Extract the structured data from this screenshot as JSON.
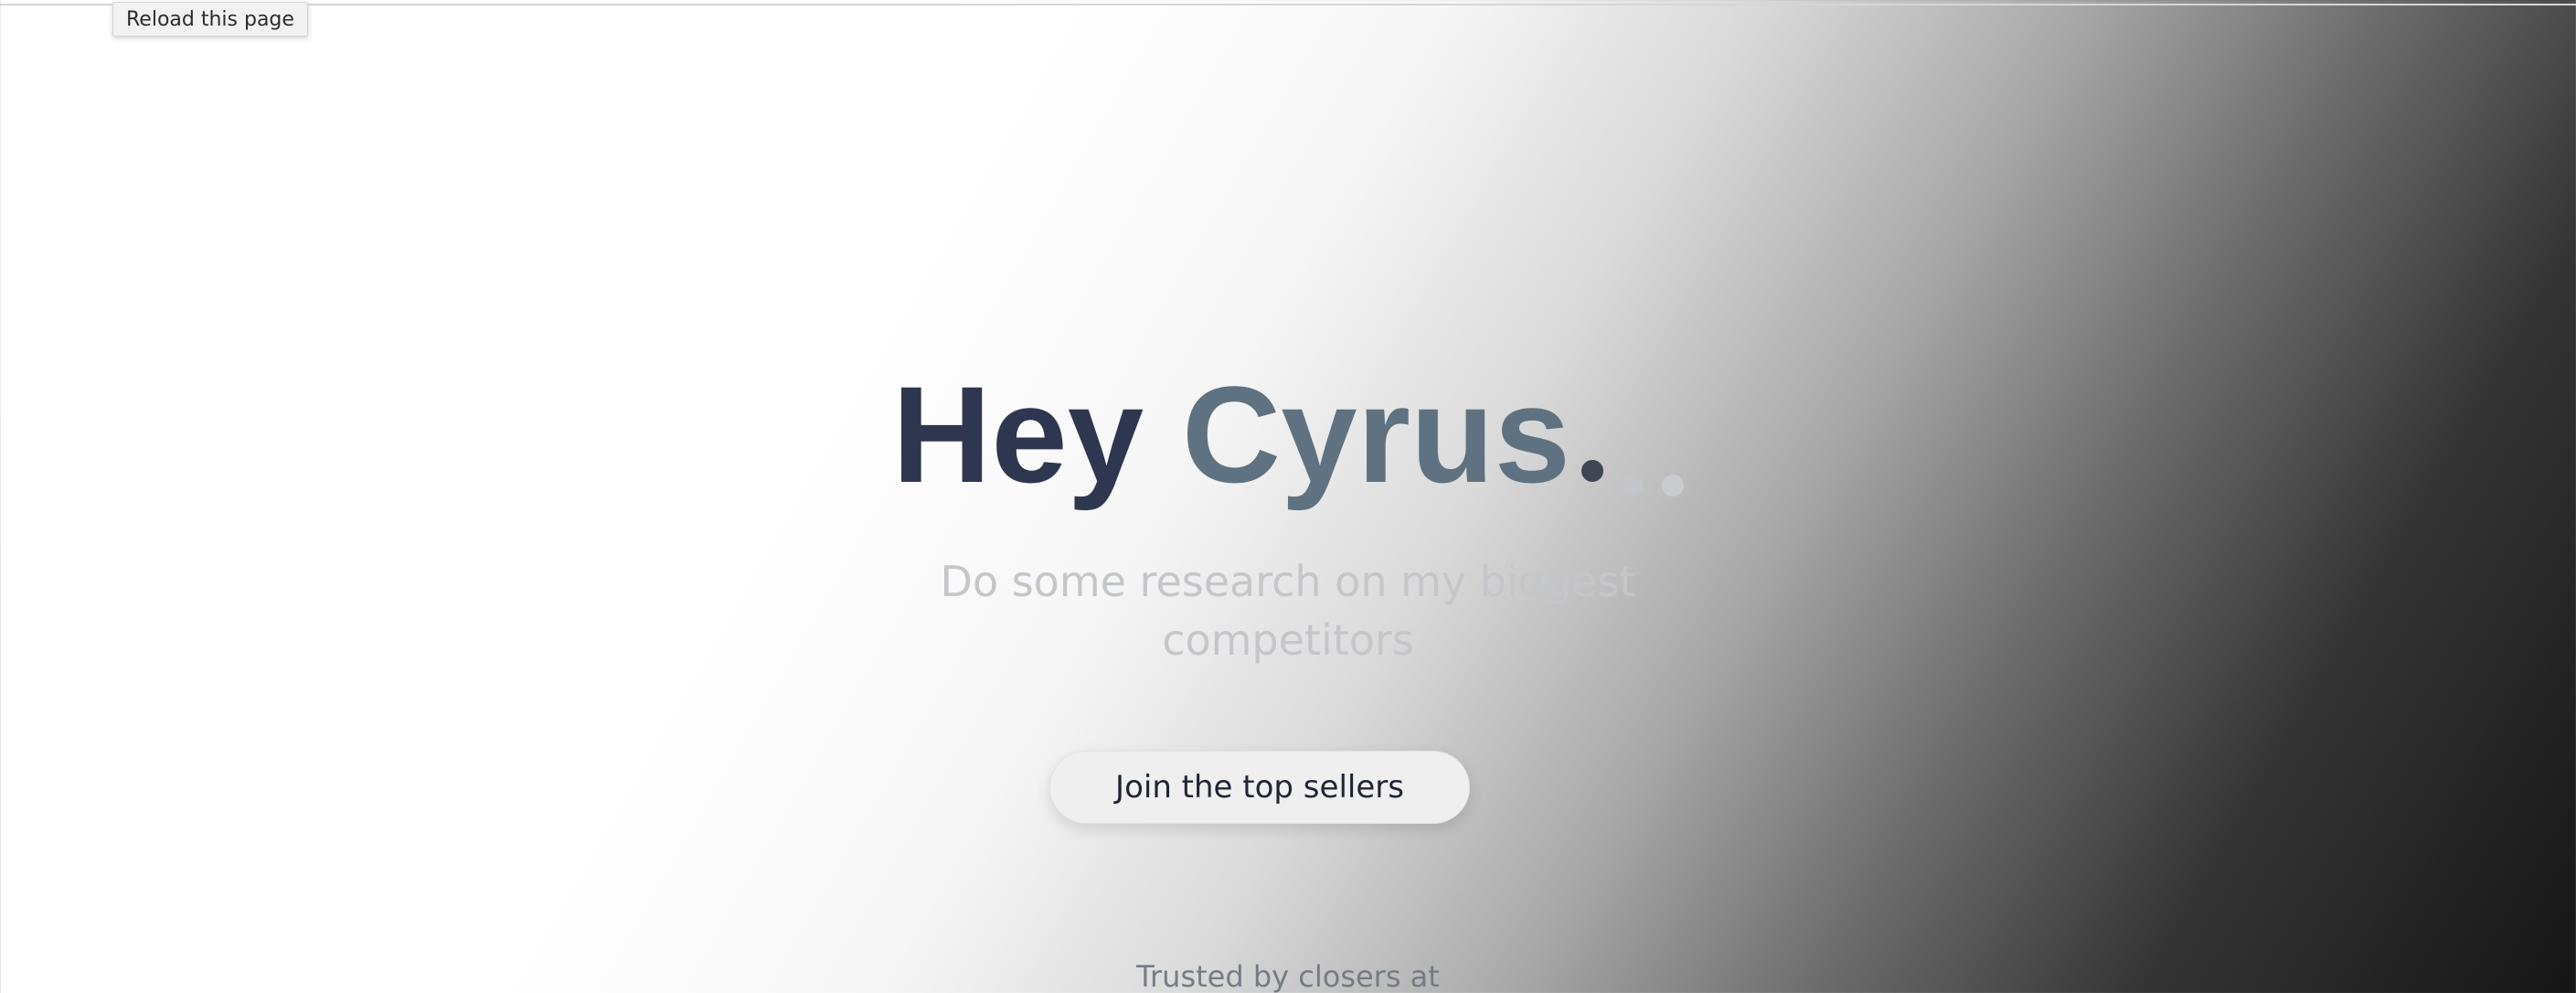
{
  "browser": {
    "tooltip": "Reload this page"
  },
  "hero": {
    "greeting_word": "Hey",
    "name": "Cyrus",
    "subtitle_line1": "Do some research on my biggest",
    "subtitle_line2": "competitors",
    "cta_label": "Join the top sellers",
    "trusted_text": "Trusted by closers at"
  },
  "colors": {
    "headline_dark": "#2f3650",
    "headline_slate": "#5f7281",
    "subtitle": "#c4c6c9",
    "cta_text": "#1f2533"
  }
}
